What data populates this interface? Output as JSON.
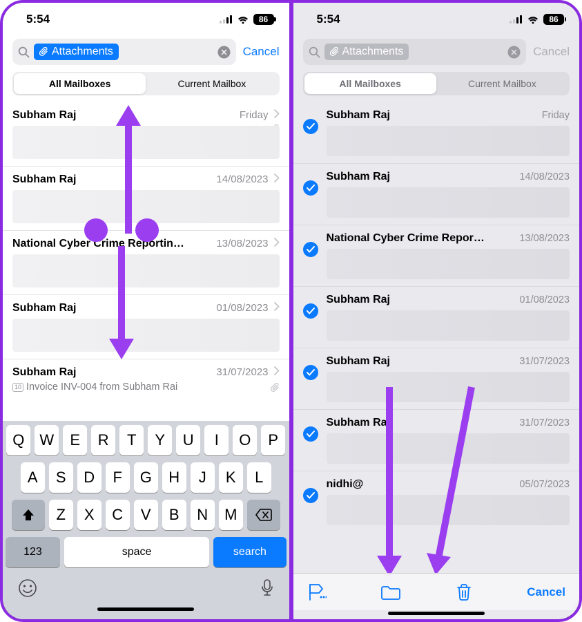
{
  "status": {
    "time": "5:54",
    "battery": "86"
  },
  "search": {
    "token_label": "Attachments",
    "cancel": "Cancel"
  },
  "seg": {
    "all": "All Mailboxes",
    "current": "Current Mailbox"
  },
  "left_rows": [
    {
      "sender": "Subham Raj",
      "date": "Friday"
    },
    {
      "sender": "Subham Raj",
      "date": "14/08/2023"
    },
    {
      "sender": "National Cyber Crime Reportin…",
      "date": "13/08/2023"
    },
    {
      "sender": "Subham Raj",
      "date": "01/08/2023"
    },
    {
      "sender": "Subham Raj",
      "date": "31/07/2023",
      "subject": "Invoice INV-004 from Subham Rai"
    }
  ],
  "right_rows": [
    {
      "sender": "Subham Raj",
      "date": "Friday"
    },
    {
      "sender": "Subham Raj",
      "date": "14/08/2023"
    },
    {
      "sender": "National Cyber Crime Repor…",
      "date": "13/08/2023"
    },
    {
      "sender": "Subham Raj",
      "date": "01/08/2023"
    },
    {
      "sender": "Subham Raj",
      "date": "31/07/2023"
    },
    {
      "sender": "Subham Raj",
      "date": "31/07/2023"
    },
    {
      "sender": "nidhi@",
      "date": "05/07/2023"
    }
  ],
  "keyboard": {
    "r1": [
      "Q",
      "W",
      "E",
      "R",
      "T",
      "Y",
      "U",
      "I",
      "O",
      "P"
    ],
    "r2": [
      "A",
      "S",
      "D",
      "F",
      "G",
      "H",
      "J",
      "K",
      "L"
    ],
    "r3": [
      "Z",
      "X",
      "C",
      "V",
      "B",
      "N",
      "M"
    ],
    "k123": "123",
    "space": "space",
    "search": "search"
  },
  "toolbar": {
    "cancel": "Cancel"
  }
}
